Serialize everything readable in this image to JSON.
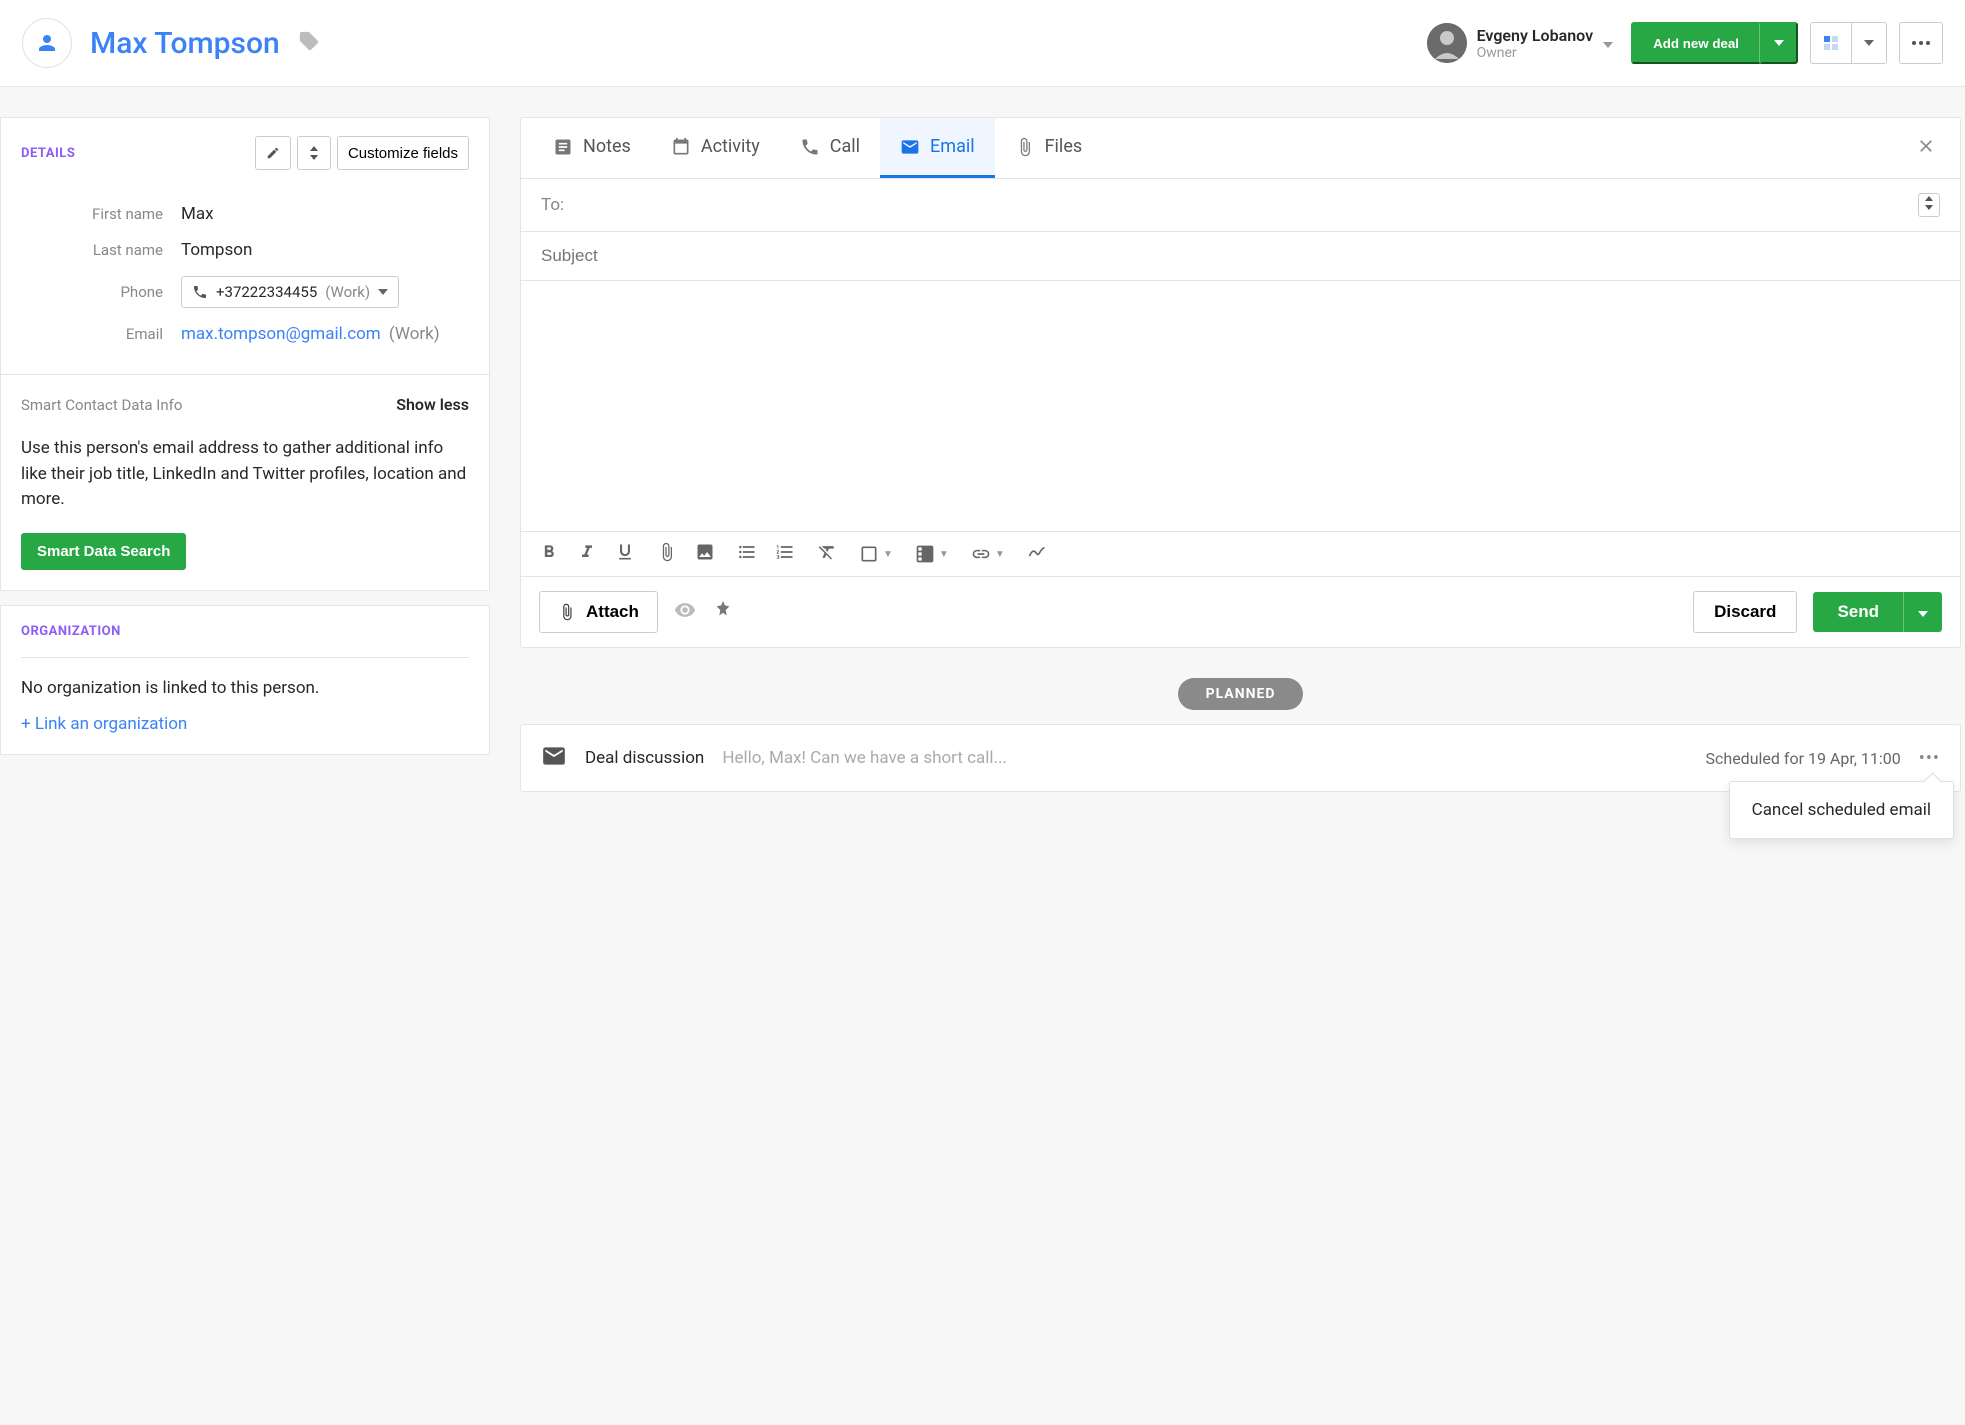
{
  "header": {
    "contact_name": "Max Tompson",
    "owner_name": "Evgeny Lobanov",
    "owner_role": "Owner",
    "add_deal_label": "Add new deal"
  },
  "details": {
    "title": "DETAILS",
    "customize_label": "Customize fields",
    "rows": {
      "first_name_label": "First name",
      "first_name_value": "Max",
      "last_name_label": "Last name",
      "last_name_value": "Tompson",
      "phone_label": "Phone",
      "phone_value": "+37222334455",
      "phone_type": "(Work)",
      "email_label": "Email",
      "email_value": "max.tompson@gmail.com",
      "email_type": "(Work)"
    },
    "smart": {
      "title": "Smart Contact Data Info",
      "toggle": "Show less",
      "description": "Use this person's email address to gather additional info like their job title, LinkedIn and Twitter profiles, location and more.",
      "button": "Smart Data Search"
    }
  },
  "organization": {
    "title": "ORGANIZATION",
    "empty_text": "No organization is linked to this person.",
    "link_action": "+ Link an organization"
  },
  "compose": {
    "tabs": {
      "notes": "Notes",
      "activity": "Activity",
      "call": "Call",
      "email": "Email",
      "files": "Files"
    },
    "to_label": "To:",
    "subject_placeholder": "Subject",
    "attach_label": "Attach",
    "discard_label": "Discard",
    "send_label": "Send"
  },
  "timeline": {
    "planned_label": "PLANNED",
    "item": {
      "title": "Deal discussion",
      "preview": "Hello, Max! Can we have a short call...",
      "scheduled": "Scheduled for 19 Apr, 11:00"
    },
    "popover": "Cancel scheduled email"
  }
}
